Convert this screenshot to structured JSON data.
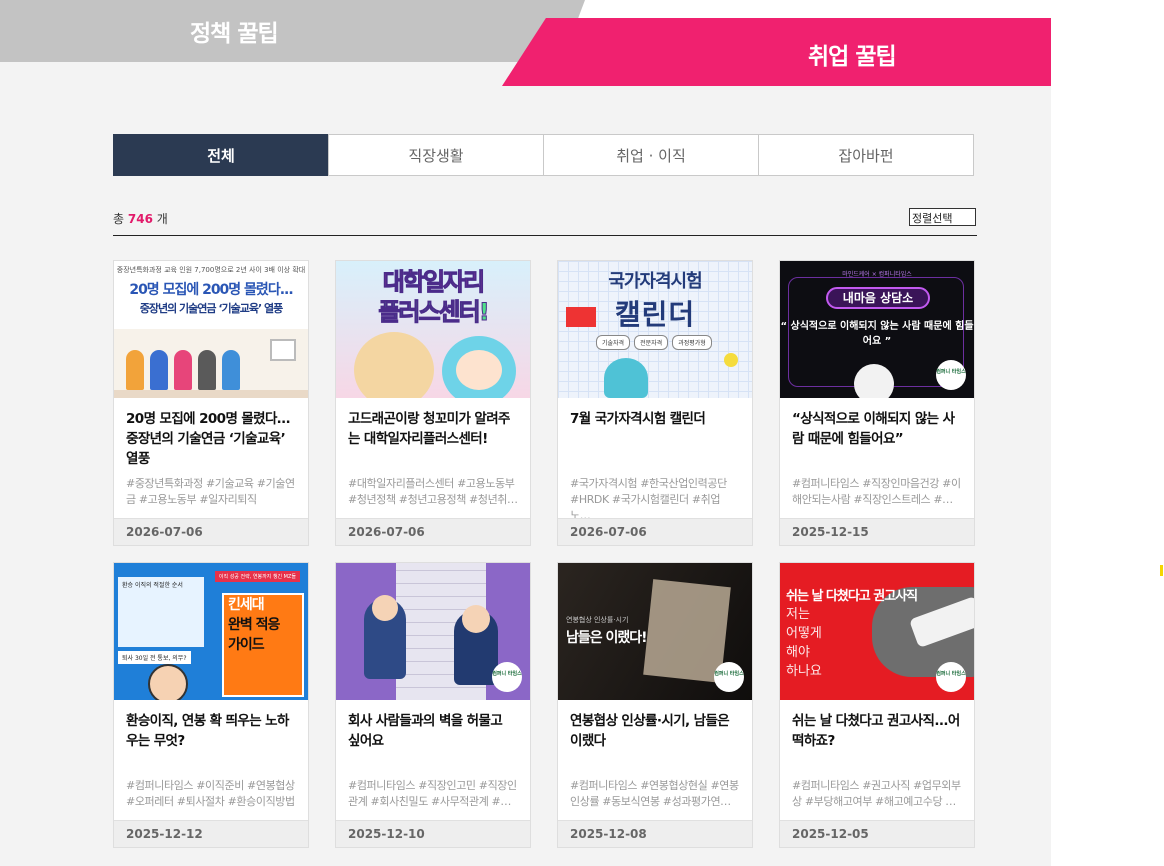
{
  "top_tabs": {
    "policy_label": "정책 꿀팁",
    "job_label": "취업 꿀팁"
  },
  "category_tabs": [
    {
      "label": "전체",
      "active": true
    },
    {
      "label": "직장생활",
      "active": false
    },
    {
      "label": "취업 · 이직",
      "active": false
    },
    {
      "label": "잡아바펀",
      "active": false
    }
  ],
  "summary": {
    "prefix": "총",
    "count": "746",
    "suffix": "개"
  },
  "sort": {
    "selected": "정렬선택"
  },
  "cards": [
    {
      "title": "20명 모집에 200명 몰렸다… 중장년의 기술연금 ‘기술교육’ 열풍",
      "tags": "#중장년특화과정 #기술교육 #기술연금 #고용노동부 #일자리퇴직",
      "date": "2026-07-06",
      "thumb": {
        "small": "중장년특화과정 교육 인원 7,700명으로 2년 사이 3배 이상 확대",
        "big": "20명 모집에 200명 몰렸다...",
        "mid": "중장년의 기술연금 ‘기술교육’ 열풍"
      }
    },
    {
      "title": "고드래곤이랑 청꼬미가 알려주는 대학일자리플러스센터!",
      "tags": "#대학일자리플러스센터 #고용노동부 #청년정책 #청년고용정책 #청년취…",
      "date": "2026-07-06",
      "thumb": {
        "l1": "대학일자리",
        "l2": "플러스센터!"
      }
    },
    {
      "title": "7월 국가자격시험 캘린더",
      "tags": "#국가자격시험 #한국산업인력공단 #HRDK #국가시험캘린더 #취업노…",
      "date": "2026-07-06",
      "thumb": {
        "h1": "국가자격시험",
        "h2": "캘린더",
        "pills": [
          "기술자격",
          "전문자격",
          "과정평가형"
        ]
      }
    },
    {
      "title": "“상식적으로 이해되지 않는 사람 때문에 힘들어요”",
      "tags": "#컴퍼니타임스 #직장인마음건강 #이해안되는사람 #직장인스트레스 #…",
      "date": "2025-12-15",
      "thumb": {
        "small": "마인드케어 × 컴퍼니타임스",
        "badge": "내마음 상담소",
        "quote": "“ 상식적으로 이해되지 않는 사람 때문에 힘들어요 ”",
        "logo": "컴퍼니 타임스"
      }
    },
    {
      "title": "환승이직, 연봉 확 띄우는 노하우는 무엇?",
      "tags": "#컴퍼니타임스 #이직준비 #연봉협상 #오퍼레터 #퇴사절차 #환승이직방법",
      "date": "2025-12-12",
      "thumb": {
        "tag": "이직 성공 전략, 연봉까지 챙긴 MZ들",
        "paper": "환승 이직의 적절한 순서",
        "note": "퇴사 30일 전 통보, 의무?",
        "b1": "킨세대",
        "b2": "완벽 적응",
        "b3": "가이드"
      }
    },
    {
      "title": "회사 사람들과의 벽을 허물고 싶어요",
      "tags": "#컴퍼니타임스 #직장인고민 #직장인관계 #회사친밀도 #사무적관계 #…",
      "date": "2025-12-10",
      "thumb": {
        "logo": "컴퍼니 타임스"
      }
    },
    {
      "title": "연봉협상 인상률·시기, 남들은 이랬다",
      "tags": "#컴퍼니타임스 #연봉협상현실 #연봉인상률 #동보식연봉 #성과평가연…",
      "date": "2025-12-08",
      "thumb": {
        "small": "연봉협상 인상률·시기",
        "big": "남들은 이랬다!",
        "logo": "컴퍼니 타임스"
      }
    },
    {
      "title": "쉬는 날 다쳤다고 권고사직...어떡하죠?",
      "tags": "#컴퍼니타임스 #권고사직 #업무외부상 #부당해고여부 #해고예고수당 …",
      "date": "2025-12-05",
      "thumb": {
        "head": "쉬는 날 다쳤다고 권고사직",
        "sub": [
          "저는",
          "어떻게",
          "해야",
          "하나요"
        ],
        "logo": "컴퍼니 타임스"
      }
    }
  ]
}
